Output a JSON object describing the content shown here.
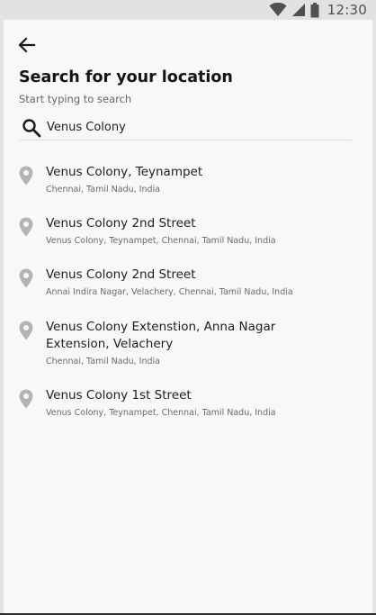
{
  "status_bar": {
    "time": "12:30",
    "icons": [
      "wifi-icon",
      "signal-icon",
      "battery-icon"
    ]
  },
  "header": {
    "back_icon": "arrow-left-icon",
    "title": "Search for your location",
    "subtitle": "Start typing to search"
  },
  "search": {
    "icon": "search-icon",
    "value": "Venus Colony",
    "placeholder": ""
  },
  "results": [
    {
      "title": "Venus Colony, Teynampet",
      "subtitle": "Chennai, Tamil Nadu, India"
    },
    {
      "title": "Venus Colony 2nd Street",
      "subtitle": "Venus Colony, Teynampet, Chennai, Tamil Nadu, India"
    },
    {
      "title": "Venus Colony 2nd Street",
      "subtitle": "Annai Indira Nagar, Velachery, Chennai, Tamil Nadu, India"
    },
    {
      "title": "Venus Colony Extenstion, Anna Nagar Extension, Velachery",
      "subtitle": "Chennai, Tamil Nadu, India"
    },
    {
      "title": "Venus Colony 1st Street",
      "subtitle": "Venus Colony, Teynampet, Chennai, Tamil Nadu, India"
    }
  ],
  "colors": {
    "status_bar_bg": "#e2e2e2",
    "background": "#f8f8f8",
    "pin": "#b4b4b4",
    "text_primary": "#1e1e1e",
    "text_secondary": "#6a6a6a"
  }
}
